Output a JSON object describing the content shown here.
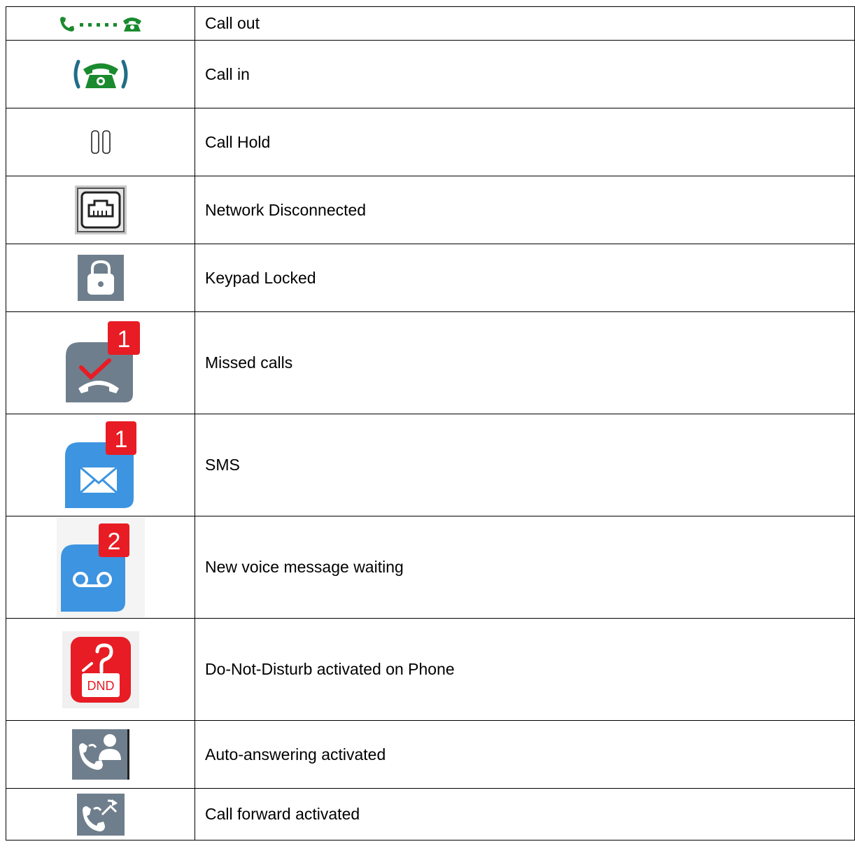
{
  "rows": [
    {
      "icon": "call-out-icon",
      "label": "Call out"
    },
    {
      "icon": "call-in-icon",
      "label": "Call in"
    },
    {
      "icon": "call-hold-icon",
      "label": "Call Hold"
    },
    {
      "icon": "network-disconnected-icon",
      "label": "Network Disconnected"
    },
    {
      "icon": "keypad-locked-icon",
      "label": "Keypad Locked"
    },
    {
      "icon": "missed-calls-icon",
      "label": "Missed calls",
      "badge": "1"
    },
    {
      "icon": "sms-icon",
      "label": "SMS",
      "badge": "1"
    },
    {
      "icon": "voice-message-icon",
      "label": "New voice message waiting",
      "badge": "2"
    },
    {
      "icon": "dnd-icon",
      "label": "Do-Not-Disturb activated on Phone",
      "icon_text": "DND"
    },
    {
      "icon": "auto-answer-icon",
      "label": "Auto-answering activated"
    },
    {
      "icon": "call-forward-icon",
      "label": "Call forward activated"
    }
  ],
  "colors": {
    "call_green": "#1a8a2e",
    "badge_red": "#e81c24",
    "icon_blue": "#3d94e0",
    "icon_gray": "#6f7e8c",
    "dnd_red": "#e81c24"
  }
}
